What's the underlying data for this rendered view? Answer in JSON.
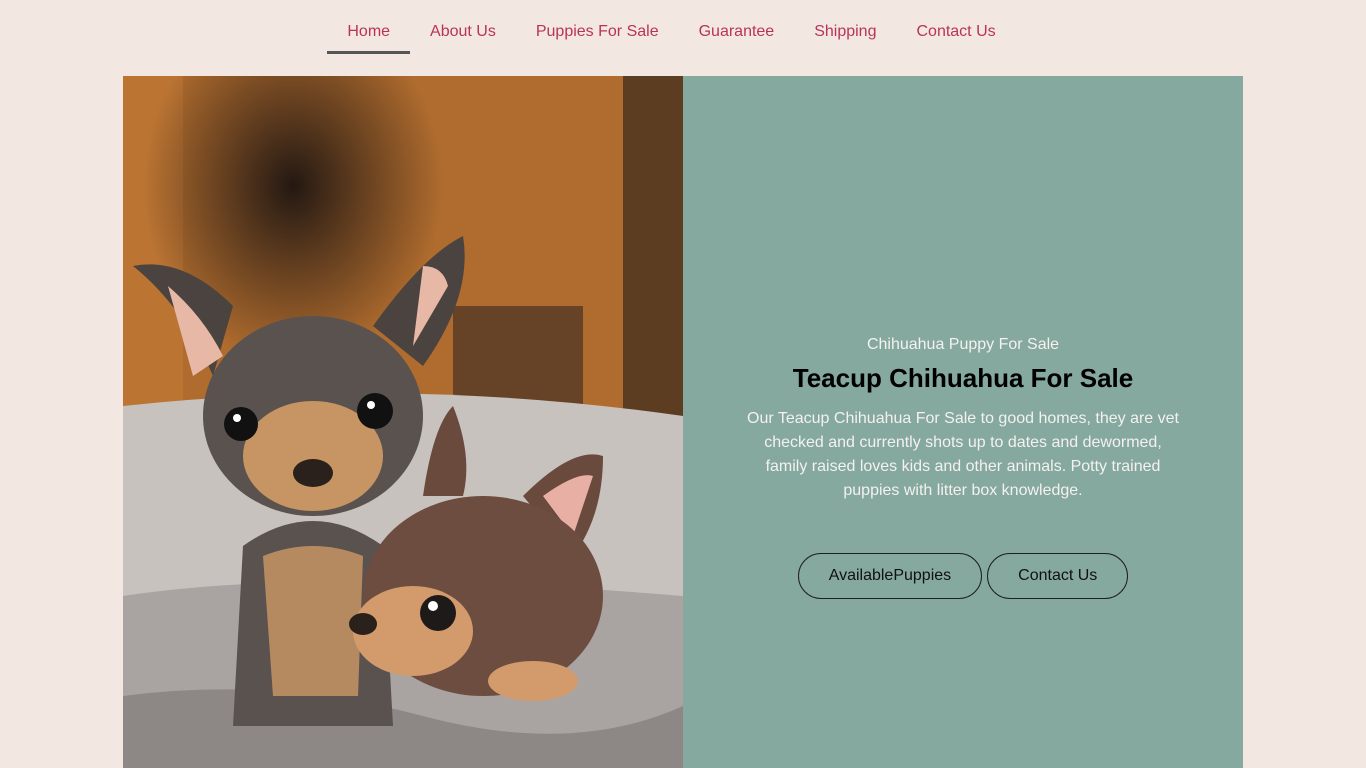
{
  "nav": {
    "items": [
      {
        "label": "Home",
        "active": true
      },
      {
        "label": "About Us"
      },
      {
        "label": "Puppies For Sale"
      },
      {
        "label": "Guarantee"
      },
      {
        "label": "Shipping"
      },
      {
        "label": "Contact Us"
      }
    ]
  },
  "hero": {
    "image_subject": "two chihuahua puppies on a fluffy blanket",
    "eyebrow": "Chihuahua Puppy For Sale",
    "title": "Teacup Chihuahua For Sale",
    "description": "Our Teacup Chihuahua For Sale to good homes, they are vet checked and currently shots up to dates and dewormed, family raised loves kids and other animals. Potty trained puppies with litter box knowledge.",
    "buttons": {
      "available": "AvailablePuppies",
      "contact": "Contact Us"
    }
  },
  "colors": {
    "background": "#f2e8e1",
    "nav_link": "#b93358",
    "panel": "#85a89f"
  }
}
